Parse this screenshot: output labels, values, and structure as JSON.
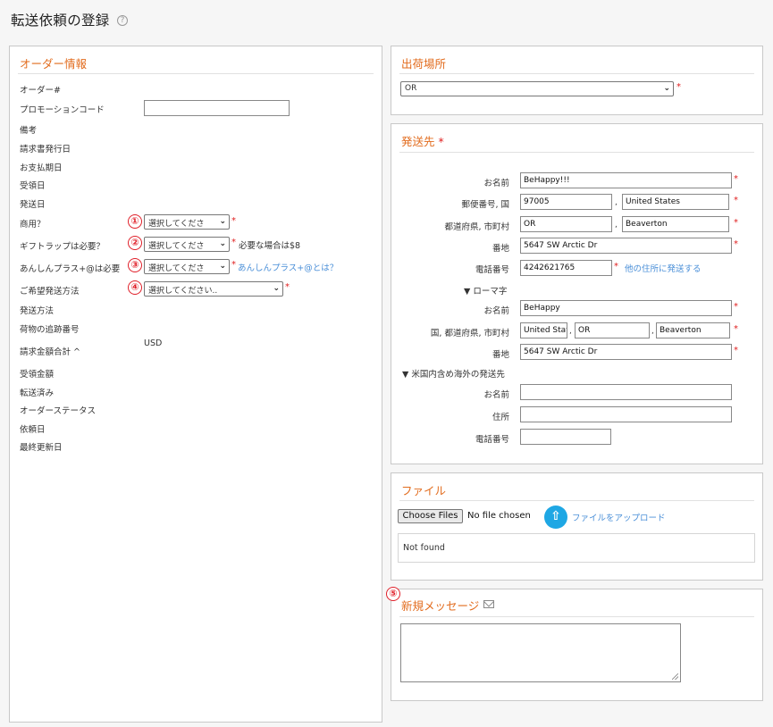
{
  "page_title": "転送依頼の登録",
  "help_icon": "?",
  "order_panel": {
    "title": "オーダー情報",
    "labels": {
      "order_no": "オーダー#",
      "promo_code": "プロモーションコード",
      "remarks": "備考",
      "invoice_date": "請求書発行日",
      "payment_date": "お支払期日",
      "received_date": "受領日",
      "ship_date": "発送日",
      "commercial": "商用？",
      "gift_wrap": "ギフトラップは必要？",
      "anshin_plus": "あんしんプラス+@は必要",
      "preferred_method": "ご希望発送方法",
      "ship_method": "発送方法",
      "tracking_no": "荷物の追跡番号",
      "invoice_total": "請求金額合計 ^",
      "received_amount": "受領金額",
      "forwarded": "転送済み",
      "order_status": "オーダーステータス",
      "request_date": "依頼日",
      "last_updated": "最終更新日"
    },
    "promo_code_value": "",
    "commercial_select": "選択してくださ",
    "gift_wrap_select": "選択してくださ",
    "anshin_select": "選択してくださ",
    "preferred_select": "選択してください..",
    "gift_wrap_note": "必要な場合は$8",
    "anshin_link": "あんしんプラス+@とは？",
    "currency": "USD",
    "markers": [
      "①",
      "②",
      "③",
      "④"
    ],
    "required_mark": "*"
  },
  "ship_from": {
    "title": "出荷場所",
    "select_value": "OR"
  },
  "ship_to": {
    "title": "発送先",
    "required_mark": "*",
    "labels": {
      "name": "お名前",
      "zip_country": "郵便番号, 国",
      "state_city": "都道府県, 市町村",
      "address": "番地",
      "phone": "電話番号",
      "romaji_toggle": "▼ ローマ字",
      "romaji_name": "お名前",
      "romaji_country_state_city": "国, 都道府県, 市町村",
      "romaji_address": "番地",
      "overseas_toggle": "▼ 米国内含め海外の発送先",
      "overseas_name": "お名前",
      "overseas_address": "住所",
      "overseas_phone": "電話番号"
    },
    "values": {
      "name": "BeHappy!!!",
      "zip": "97005",
      "country": "United States",
      "state": "OR",
      "city": "Beaverton",
      "address": "5647 SW Arctic Dr",
      "phone": "4242621765",
      "romaji_name": "BeHappy",
      "romaji_country": "United Stat",
      "romaji_state": "OR",
      "romaji_city": "Beaverton",
      "romaji_address": "5647 SW Arctic Dr",
      "overseas_name": "",
      "overseas_address": "",
      "overseas_phone": ""
    },
    "other_address_link": "他の住所に発送する",
    "comma": ","
  },
  "files": {
    "title": "ファイル",
    "choose_button": "Choose Files",
    "no_file": "No file chosen",
    "upload_link": "ファイルをアップロード",
    "upload_icon": "⇧",
    "empty_text": "Not found"
  },
  "message": {
    "title": "新規メッセージ",
    "marker": "⑤",
    "body": ""
  }
}
